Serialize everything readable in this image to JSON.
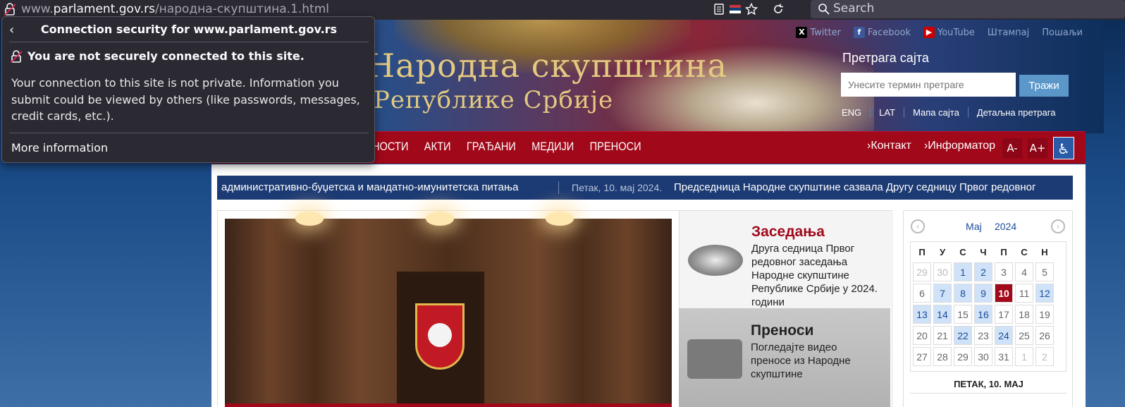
{
  "browser": {
    "url_host": "www.parlament.gov.rs",
    "url_path": "/народна-скупштина.1.html",
    "url_prefix": "www.",
    "url_domain": "parlament.gov.rs",
    "search_placeholder": "Search"
  },
  "popup": {
    "title": "Connection security for www.parlament.gov.rs",
    "back_icon": "‹",
    "warning": "You are not securely connected to this site.",
    "body": "Your connection to this site is not private. Information you submit could be viewed by others (like passwords, messages, credit cards, etc.).",
    "more": "More information"
  },
  "header": {
    "title_line1": "Народна скупштина",
    "title_line2": "Републике Србије",
    "social": [
      {
        "label": "Twitter",
        "badge": "X",
        "color": "#000000"
      },
      {
        "label": "Facebook",
        "badge": "f",
        "color": "#3b5998"
      },
      {
        "label": "YouTube",
        "badge": "▶",
        "color": "#cc0000"
      },
      {
        "label": "Штампај"
      },
      {
        "label": "Пошаљи"
      }
    ],
    "site_search_label": "Претрага сајта",
    "site_search_placeholder": "Унесите термин претраге",
    "site_search_button": "Тражи",
    "links": [
      "ENG",
      "LAT",
      "Мапа сајта",
      "Детаљна претрага"
    ]
  },
  "nav": {
    "items": [
      "НОСТИ",
      "АКТИ",
      "ГРАЂАНИ",
      "МЕДИЈИ",
      "ПРЕНОСИ"
    ],
    "right": [
      "›Контакт",
      "›Информатор"
    ],
    "font_minus": "A-",
    "font_plus": "A+",
    "accessibility_icon": "♿"
  },
  "ticker": {
    "text1": "административно-буџетска и мандатно-имунитетска питања",
    "date": "Петак, 10. мај 2024.",
    "text2": "Председница Народне скупштине сазвала Другу седницу Првог редовног"
  },
  "cards": [
    {
      "title": "Заседања",
      "text": "Друга седница Првог редовног заседања Народне скупштине Републике Србије у 2024. години"
    },
    {
      "title": "Преноси",
      "text": "Погледајте видео преносе из Народне скупштине"
    }
  ],
  "calendar": {
    "prev": "‹",
    "next": "›",
    "month": "Мај",
    "year": "2024",
    "weekdays": [
      "П",
      "У",
      "С",
      "Ч",
      "П",
      "С",
      "Н"
    ],
    "weeks": [
      [
        "29",
        "30",
        "1",
        "2",
        "3",
        "4",
        "5"
      ],
      [
        "6",
        "7",
        "8",
        "9",
        "10",
        "11",
        "12"
      ],
      [
        "13",
        "14",
        "15",
        "16",
        "17",
        "18",
        "19"
      ],
      [
        "20",
        "21",
        "22",
        "23",
        "24",
        "25",
        "26"
      ],
      [
        "27",
        "28",
        "29",
        "30",
        "31",
        "1",
        "2"
      ]
    ],
    "caption": "ПЕТАК, 10. МАЈ"
  }
}
